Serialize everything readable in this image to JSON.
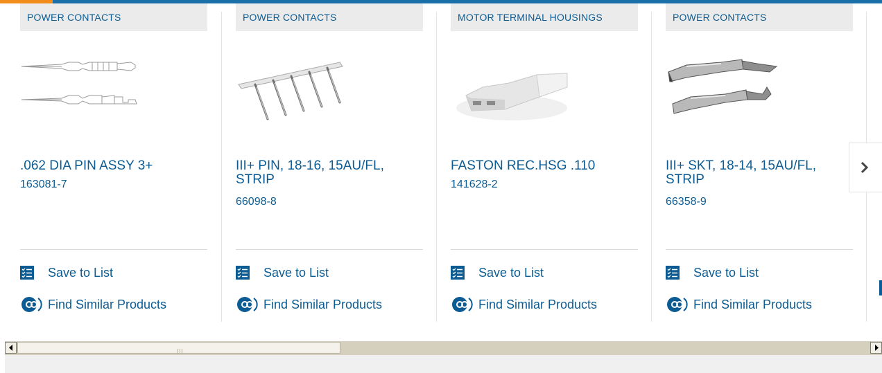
{
  "colors": {
    "link": "#0c5c93",
    "accent_orange": "#f28c1b",
    "top_bar": "#1a6fa8",
    "category_bg": "#ebebeb"
  },
  "products": [
    {
      "category": "POWER CONTACTS",
      "title": ".062 DIA PIN ASSY 3+",
      "part_number": "163081-7",
      "save_label": "Save to List",
      "find_label": "Find Similar Products",
      "image": "pin-contact-diagram"
    },
    {
      "category": "POWER CONTACTS",
      "title": "III+ PIN, 18-16, 15AU/FL, STRIP",
      "part_number": "66098-8",
      "save_label": "Save to List",
      "find_label": "Find Similar Products",
      "image": "pin-contacts-strip"
    },
    {
      "category": "MOTOR TERMINAL HOUSINGS",
      "title": "FASTON REC.HSG .110",
      "part_number": "141628-2",
      "save_label": "Save to List",
      "find_label": "Find Similar Products",
      "image": "white-housing"
    },
    {
      "category": "POWER CONTACTS",
      "title": "III+ SKT, 18-14, 15AU/FL, STRIP",
      "part_number": "66358-9",
      "save_label": "Save to List",
      "find_label": "Find Similar Products",
      "image": "socket-contacts"
    }
  ],
  "icons": {
    "save": "checklist-icon",
    "find": "similar-products-icon",
    "next": "chevron-right-icon",
    "scroll_left": "arrow-left-icon",
    "scroll_right": "arrow-right-icon"
  }
}
